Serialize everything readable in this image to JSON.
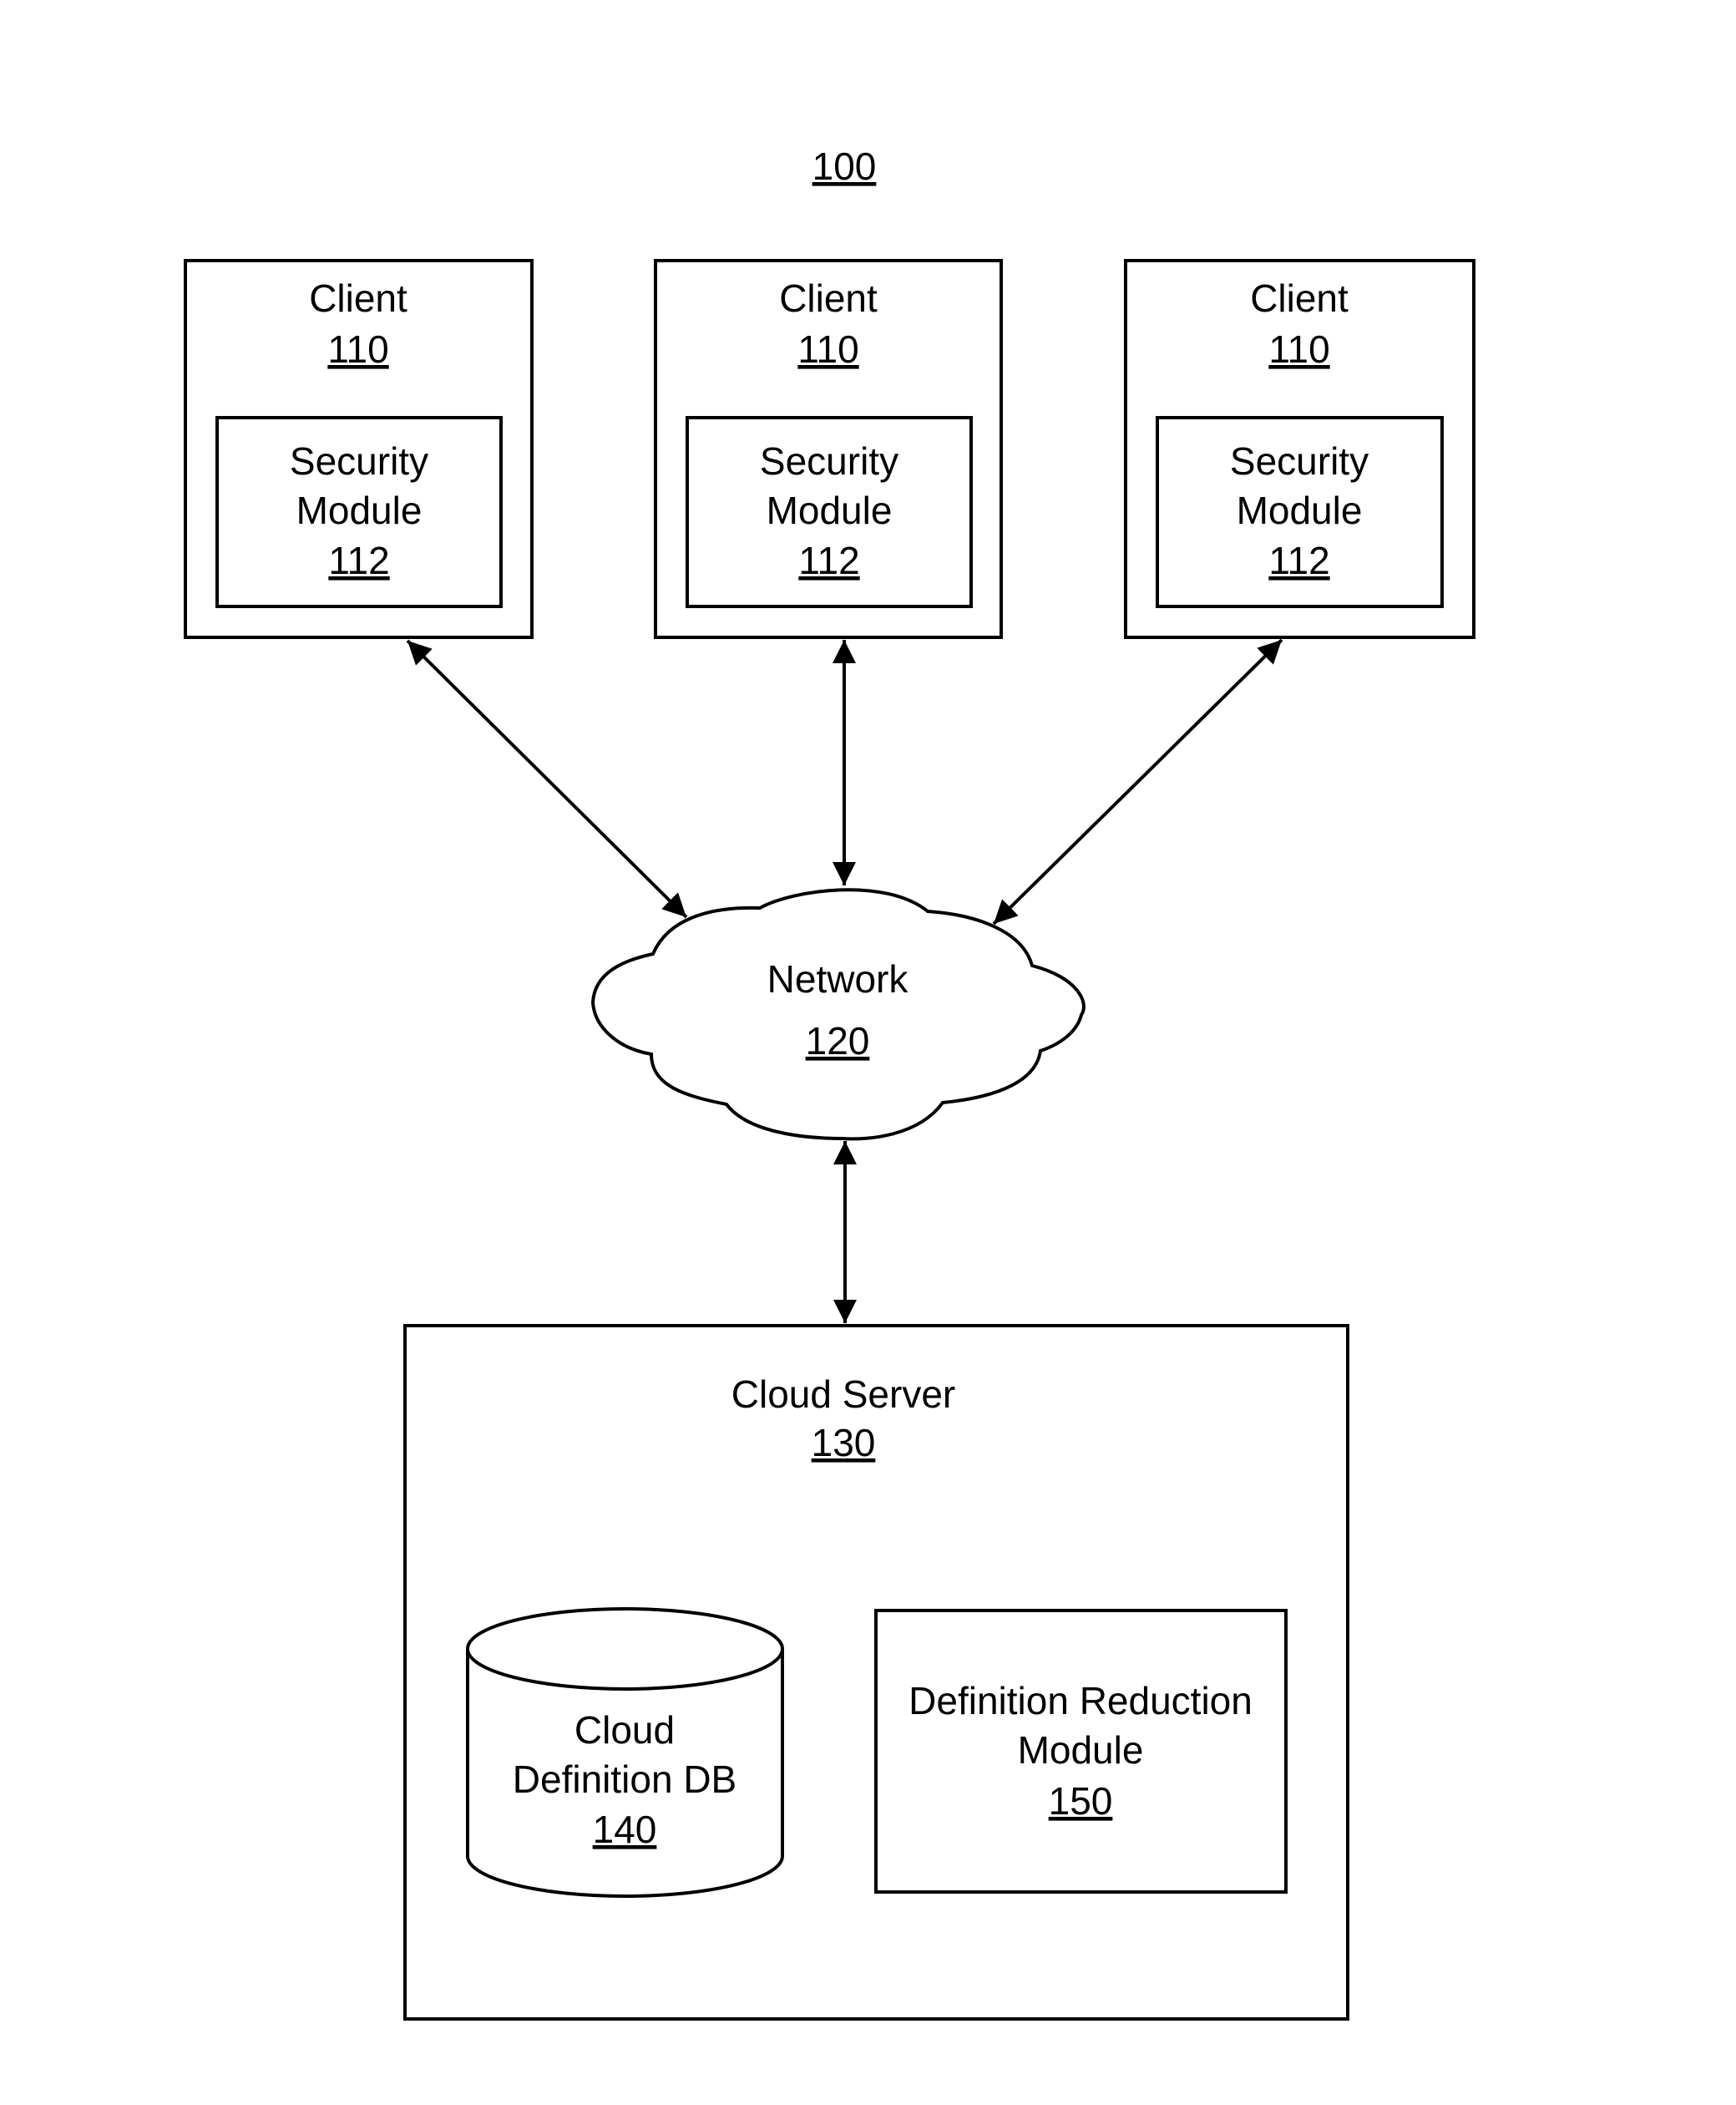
{
  "figure": {
    "ref": "100"
  },
  "clients": [
    {
      "title": "Client",
      "ref": "110",
      "module": {
        "line1": "Security",
        "line2": "Module",
        "ref": "112"
      }
    },
    {
      "title": "Client",
      "ref": "110",
      "module": {
        "line1": "Security",
        "line2": "Module",
        "ref": "112"
      }
    },
    {
      "title": "Client",
      "ref": "110",
      "module": {
        "line1": "Security",
        "line2": "Module",
        "ref": "112"
      }
    }
  ],
  "network": {
    "title": "Network",
    "ref": "120"
  },
  "server": {
    "title": "Cloud Server",
    "ref": "130",
    "database": {
      "line1": "Cloud",
      "line2": "Definition DB",
      "ref": "140"
    },
    "module": {
      "line1": "Definition Reduction",
      "line2": "Module",
      "ref": "150"
    }
  },
  "connections": [
    {
      "from": "client-1",
      "to": "network",
      "type": "bidirectional"
    },
    {
      "from": "client-2",
      "to": "network",
      "type": "bidirectional"
    },
    {
      "from": "client-3",
      "to": "network",
      "type": "bidirectional"
    },
    {
      "from": "network",
      "to": "server",
      "type": "bidirectional"
    }
  ]
}
